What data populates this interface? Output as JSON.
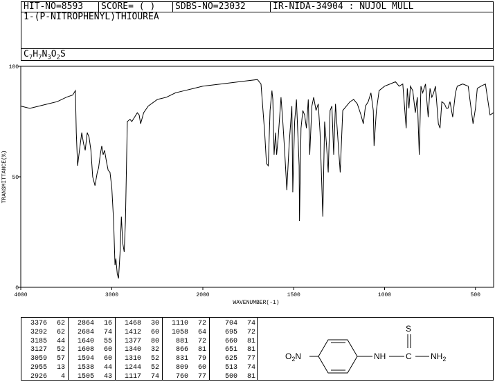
{
  "header": {
    "hit_no": "HIT-NO=8593",
    "score": "SCORE=  (   )",
    "sdbs_no": "SDBS-NO=23032",
    "ir_info": "IR-NIDA-34904 : NUJOL MULL",
    "compound_name": "1-(P-NITROPHENYL)THIOUREA",
    "formula": {
      "c": "C",
      "c_n": "7",
      "h": "H",
      "h_n": "7",
      "n": "N",
      "n_n": "3",
      "o": "O",
      "o_n": "2",
      "s": "S"
    }
  },
  "chart_data": {
    "type": "line",
    "xlabel": "WAVENUMBER(-1)",
    "ylabel": "TRANSMITTANCE(%)",
    "xlim": [
      4000,
      400
    ],
    "ylim": [
      0,
      100
    ],
    "x_ticks": [
      "4000",
      "3000",
      "2000",
      "1500",
      "1000",
      "500"
    ],
    "y_ticks": [
      "100",
      "50",
      "0"
    ],
    "series": [
      {
        "points": [
          [
            4000,
            82
          ],
          [
            3900,
            81
          ],
          [
            3800,
            82
          ],
          [
            3700,
            83
          ],
          [
            3600,
            84
          ],
          [
            3500,
            86
          ],
          [
            3430,
            87
          ],
          [
            3400,
            89
          ],
          [
            3390,
            70
          ],
          [
            3376,
            55
          ],
          [
            3355,
            62
          ],
          [
            3330,
            70
          ],
          [
            3310,
            65
          ],
          [
            3292,
            62
          ],
          [
            3270,
            70
          ],
          [
            3250,
            68
          ],
          [
            3230,
            62
          ],
          [
            3210,
            50
          ],
          [
            3185,
            46
          ],
          [
            3160,
            52
          ],
          [
            3145,
            54
          ],
          [
            3127,
            60
          ],
          [
            3110,
            64
          ],
          [
            3095,
            60
          ],
          [
            3080,
            62
          ],
          [
            3059,
            57
          ],
          [
            3040,
            53
          ],
          [
            3020,
            52
          ],
          [
            3000,
            45
          ],
          [
            2980,
            30
          ],
          [
            2965,
            10
          ],
          [
            2955,
            13
          ],
          [
            2940,
            6
          ],
          [
            2926,
            4
          ],
          [
            2910,
            15
          ],
          [
            2895,
            32
          ],
          [
            2880,
            20
          ],
          [
            2864,
            16
          ],
          [
            2850,
            30
          ],
          [
            2830,
            75
          ],
          [
            2800,
            76
          ],
          [
            2780,
            75
          ],
          [
            2750,
            77
          ],
          [
            2720,
            79
          ],
          [
            2700,
            78
          ],
          [
            2684,
            74
          ],
          [
            2650,
            79
          ],
          [
            2600,
            82
          ],
          [
            2500,
            85
          ],
          [
            2400,
            86
          ],
          [
            2300,
            88
          ],
          [
            2200,
            89
          ],
          [
            2100,
            90
          ],
          [
            2000,
            91
          ],
          [
            1900,
            92
          ],
          [
            1800,
            93
          ],
          [
            1700,
            94
          ],
          [
            1680,
            92
          ],
          [
            1660,
            70
          ],
          [
            1650,
            56
          ],
          [
            1640,
            55
          ],
          [
            1630,
            80
          ],
          [
            1620,
            89
          ],
          [
            1615,
            85
          ],
          [
            1608,
            60
          ],
          [
            1600,
            70
          ],
          [
            1594,
            60
          ],
          [
            1585,
            68
          ],
          [
            1570,
            86
          ],
          [
            1560,
            75
          ],
          [
            1550,
            62
          ],
          [
            1538,
            44
          ],
          [
            1525,
            65
          ],
          [
            1510,
            82
          ],
          [
            1505,
            43
          ],
          [
            1495,
            75
          ],
          [
            1485,
            85
          ],
          [
            1470,
            55
          ],
          [
            1468,
            30
          ],
          [
            1460,
            72
          ],
          [
            1450,
            80
          ],
          [
            1440,
            78
          ],
          [
            1430,
            72
          ],
          [
            1420,
            85
          ],
          [
            1412,
            60
          ],
          [
            1400,
            82
          ],
          [
            1390,
            86
          ],
          [
            1377,
            80
          ],
          [
            1365,
            83
          ],
          [
            1355,
            70
          ],
          [
            1340,
            32
          ],
          [
            1330,
            75
          ],
          [
            1320,
            65
          ],
          [
            1310,
            52
          ],
          [
            1300,
            80
          ],
          [
            1290,
            82
          ],
          [
            1280,
            60
          ],
          [
            1270,
            83
          ],
          [
            1244,
            52
          ],
          [
            1230,
            80
          ],
          [
            1210,
            82
          ],
          [
            1190,
            84
          ],
          [
            1170,
            85
          ],
          [
            1150,
            83
          ],
          [
            1130,
            78
          ],
          [
            1117,
            74
          ],
          [
            1105,
            82
          ],
          [
            1090,
            84
          ],
          [
            1075,
            88
          ],
          [
            1062,
            80
          ],
          [
            1058,
            64
          ],
          [
            1045,
            80
          ],
          [
            1030,
            89
          ],
          [
            1000,
            91
          ],
          [
            970,
            92
          ],
          [
            940,
            93
          ],
          [
            920,
            91
          ],
          [
            900,
            92
          ],
          [
            881,
            72
          ],
          [
            875,
            90
          ],
          [
            866,
            81
          ],
          [
            858,
            91
          ],
          [
            845,
            89
          ],
          [
            831,
            79
          ],
          [
            820,
            86
          ],
          [
            809,
            60
          ],
          [
            800,
            91
          ],
          [
            790,
            88
          ],
          [
            775,
            92
          ],
          [
            760,
            77
          ],
          [
            750,
            90
          ],
          [
            740,
            86
          ],
          [
            730,
            88
          ],
          [
            720,
            91
          ],
          [
            704,
            74
          ],
          [
            695,
            72
          ],
          [
            685,
            84
          ],
          [
            670,
            83
          ],
          [
            660,
            81
          ],
          [
            651,
            81
          ],
          [
            640,
            84
          ],
          [
            625,
            77
          ],
          [
            610,
            88
          ],
          [
            600,
            91
          ],
          [
            570,
            92
          ],
          [
            540,
            91
          ],
          [
            513,
            74
          ],
          [
            500,
            81
          ],
          [
            490,
            90
          ],
          [
            470,
            91
          ],
          [
            445,
            92
          ],
          [
            420,
            78
          ],
          [
            400,
            79
          ]
        ]
      }
    ]
  },
  "peaks": [
    [
      [
        "3376",
        "62"
      ],
      [
        "3292",
        "62"
      ],
      [
        "3185",
        "44"
      ],
      [
        "3127",
        "52"
      ],
      [
        "3059",
        "57"
      ],
      [
        "2955",
        "13"
      ],
      [
        "2926",
        "4"
      ]
    ],
    [
      [
        "2864",
        "16"
      ],
      [
        "2684",
        "74"
      ],
      [
        "1640",
        "55"
      ],
      [
        "1608",
        "60"
      ],
      [
        "1594",
        "60"
      ],
      [
        "1538",
        "44"
      ],
      [
        "1505",
        "43"
      ]
    ],
    [
      [
        "1468",
        "30"
      ],
      [
        "1412",
        "60"
      ],
      [
        "1377",
        "80"
      ],
      [
        "1340",
        "32"
      ],
      [
        "1310",
        "52"
      ],
      [
        "1244",
        "52"
      ],
      [
        "1117",
        "74"
      ]
    ],
    [
      [
        "1110",
        "72"
      ],
      [
        "1058",
        "64"
      ],
      [
        "881",
        "72"
      ],
      [
        "866",
        "81"
      ],
      [
        "831",
        "79"
      ],
      [
        "809",
        "60"
      ],
      [
        "760",
        "77"
      ]
    ],
    [
      [
        "704",
        "74"
      ],
      [
        "695",
        "72"
      ],
      [
        "660",
        "81"
      ],
      [
        "651",
        "81"
      ],
      [
        "625",
        "77"
      ],
      [
        "513",
        "74"
      ],
      [
        "500",
        "81"
      ]
    ]
  ],
  "structure": {
    "left_group_main": "O",
    "left_group_sub": "2",
    "left_group_tail": "N",
    "nh_label": "NH",
    "c_label": "C",
    "s_label": "S",
    "nh2_main": "NH",
    "nh2_sub": "2"
  }
}
